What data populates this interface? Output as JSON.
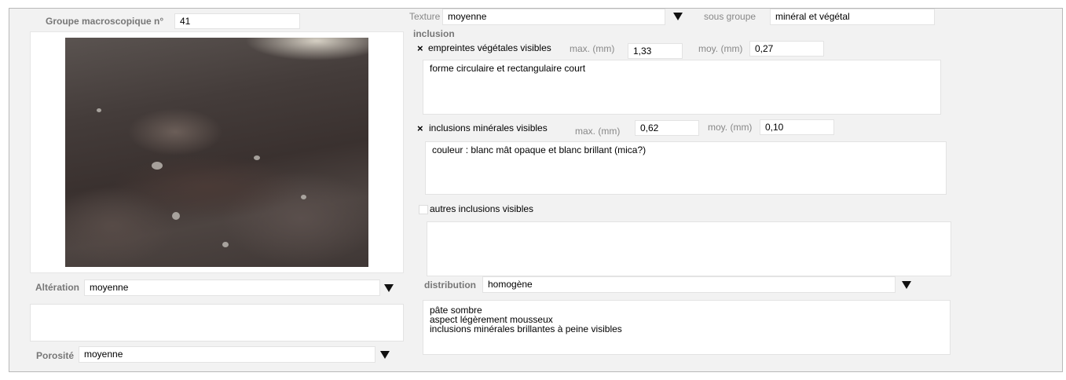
{
  "groupe": {
    "label": "Groupe macroscopique n°",
    "value": "41"
  },
  "texture": {
    "label": "Texture",
    "value": "moyenne"
  },
  "sous_groupe": {
    "label": "sous groupe",
    "value": "minéral et végétal"
  },
  "inclusion": {
    "title": "inclusion"
  },
  "empreintes": {
    "check": "×",
    "label": "empreintes végétales visibles",
    "max_label": "max. (mm)",
    "max_value": "1,33",
    "moy_label": "moy. (mm)",
    "moy_value": "0,27",
    "note": "forme circulaire et rectangulaire court"
  },
  "mineral": {
    "check": "×",
    "label": "inclusions minérales visibles",
    "max_label": "max. (mm)",
    "max_value": "0,62",
    "moy_label": "moy. (mm)",
    "moy_value": "0,10",
    "note": "couleur : blanc mât opaque et blanc brillant (mica?)"
  },
  "autres": {
    "label": "autres inclusions visibles",
    "note": ""
  },
  "distribution": {
    "label": "distribution",
    "value": "homogène"
  },
  "description": "pâte sombre\naspect légèrement mousseux\ninclusions minérales brillantes à peine visibles",
  "alteration": {
    "label": "Altération",
    "value": "moyenne",
    "note": ""
  },
  "porosite": {
    "label": "Porosité",
    "value": "moyenne"
  },
  "icons": {
    "dropdown": "triangle-down",
    "check": "x-mark"
  }
}
